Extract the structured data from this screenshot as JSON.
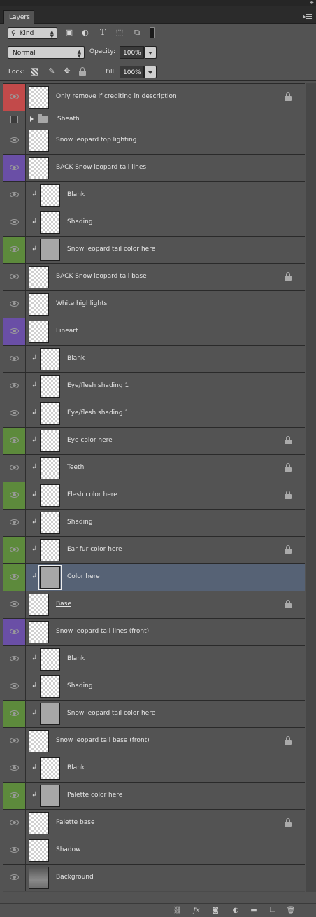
{
  "panel": {
    "tab_label": "Layers"
  },
  "filter": {
    "kind_label": "Kind"
  },
  "blend": {
    "mode": "Normal",
    "opacity_label": "Opacity:",
    "opacity_value": "100%"
  },
  "lockrow": {
    "lock_label": "Lock:",
    "fill_label": "Fill:",
    "fill_value": "100%"
  },
  "layers": [
    {
      "name": "Only remove if crediting in description",
      "color": "#c24a4a",
      "locked": true,
      "clip": false,
      "underline": false,
      "visible": true,
      "thumb": "checker"
    },
    {
      "name": "Sheath",
      "color": "",
      "locked": false,
      "clip": false,
      "underline": false,
      "visible": false,
      "thumb": "folder",
      "group": true
    },
    {
      "name": "Snow leopard top lighting",
      "color": "",
      "locked": false,
      "clip": false,
      "underline": false,
      "visible": true,
      "thumb": "checker"
    },
    {
      "name": "BACK Snow leopard tail lines",
      "color": "#6a4fa6",
      "locked": false,
      "clip": false,
      "underline": false,
      "visible": true,
      "thumb": "checker"
    },
    {
      "name": "Blank",
      "color": "",
      "locked": false,
      "clip": true,
      "underline": false,
      "visible": true,
      "thumb": "checker"
    },
    {
      "name": "Shading",
      "color": "",
      "locked": false,
      "clip": true,
      "underline": false,
      "visible": true,
      "thumb": "checker"
    },
    {
      "name": "Snow leopard tail color here",
      "color": "#5d8a3c",
      "locked": false,
      "clip": true,
      "underline": false,
      "visible": true,
      "thumb": "grey"
    },
    {
      "name": "BACK Snow leopard tail base",
      "color": "",
      "locked": true,
      "clip": false,
      "underline": true,
      "visible": true,
      "thumb": "checker"
    },
    {
      "name": "White highlights",
      "color": "",
      "locked": false,
      "clip": false,
      "underline": false,
      "visible": true,
      "thumb": "checker"
    },
    {
      "name": "Lineart",
      "color": "#6a4fa6",
      "locked": false,
      "clip": false,
      "underline": false,
      "visible": true,
      "thumb": "checker"
    },
    {
      "name": "Blank",
      "color": "",
      "locked": false,
      "clip": true,
      "underline": false,
      "visible": true,
      "thumb": "checker"
    },
    {
      "name": "Eye/flesh shading 1",
      "color": "",
      "locked": false,
      "clip": true,
      "underline": false,
      "visible": true,
      "thumb": "checker"
    },
    {
      "name": "Eye/flesh shading 1",
      "color": "",
      "locked": false,
      "clip": true,
      "underline": false,
      "visible": true,
      "thumb": "checker"
    },
    {
      "name": "Eye color here",
      "color": "#5d8a3c",
      "locked": true,
      "clip": true,
      "underline": false,
      "visible": true,
      "thumb": "checker"
    },
    {
      "name": "Teeth",
      "color": "",
      "locked": true,
      "clip": true,
      "underline": false,
      "visible": true,
      "thumb": "checker"
    },
    {
      "name": "Flesh color here",
      "color": "#5d8a3c",
      "locked": true,
      "clip": true,
      "underline": false,
      "visible": true,
      "thumb": "checker"
    },
    {
      "name": "Shading",
      "color": "",
      "locked": false,
      "clip": true,
      "underline": false,
      "visible": true,
      "thumb": "checker"
    },
    {
      "name": "Ear fur color here",
      "color": "#5d8a3c",
      "locked": true,
      "clip": true,
      "underline": false,
      "visible": true,
      "thumb": "checker"
    },
    {
      "name": "Color here",
      "color": "#5d8a3c",
      "locked": false,
      "clip": true,
      "underline": false,
      "visible": true,
      "thumb": "grey",
      "selected": true
    },
    {
      "name": "Base",
      "color": "",
      "locked": true,
      "clip": false,
      "underline": true,
      "visible": true,
      "thumb": "checker"
    },
    {
      "name": "Snow leopard tail lines (front)",
      "color": "#6a4fa6",
      "locked": false,
      "clip": false,
      "underline": false,
      "visible": true,
      "thumb": "checker"
    },
    {
      "name": "Blank",
      "color": "",
      "locked": false,
      "clip": true,
      "underline": false,
      "visible": true,
      "thumb": "checker"
    },
    {
      "name": "Shading",
      "color": "",
      "locked": false,
      "clip": true,
      "underline": false,
      "visible": true,
      "thumb": "checker"
    },
    {
      "name": "Snow leopard tail color here",
      "color": "#5d8a3c",
      "locked": false,
      "clip": true,
      "underline": false,
      "visible": true,
      "thumb": "grey"
    },
    {
      "name": "Snow leopard tail base (front)",
      "color": "",
      "locked": true,
      "clip": false,
      "underline": true,
      "visible": true,
      "thumb": "checker"
    },
    {
      "name": "Blank",
      "color": "",
      "locked": false,
      "clip": true,
      "underline": false,
      "visible": true,
      "thumb": "checker"
    },
    {
      "name": "Palette color here",
      "color": "#5d8a3c",
      "locked": false,
      "clip": true,
      "underline": false,
      "visible": true,
      "thumb": "grey"
    },
    {
      "name": "Palette base",
      "color": "",
      "locked": true,
      "clip": false,
      "underline": true,
      "visible": true,
      "thumb": "checker"
    },
    {
      "name": "Shadow",
      "color": "",
      "locked": false,
      "clip": false,
      "underline": false,
      "visible": true,
      "thumb": "checker"
    },
    {
      "name": "Background",
      "color": "",
      "locked": false,
      "clip": false,
      "underline": false,
      "visible": true,
      "thumb": "gradient"
    }
  ],
  "icons": {
    "filter_icons": [
      "image-filter-icon",
      "adjustment-filter-icon",
      "type-filter-icon",
      "shape-filter-icon",
      "smart-object-filter-icon",
      "filter-toggle-icon"
    ],
    "lock_icons": [
      "lock-transparent-icon",
      "lock-paint-icon",
      "lock-position-icon",
      "lock-all-icon"
    ],
    "bottom_icons": [
      "link-layers-icon",
      "fx-icon",
      "add-mask-icon",
      "new-adjustment-icon",
      "new-group-icon",
      "new-layer-icon",
      "delete-layer-icon"
    ]
  }
}
